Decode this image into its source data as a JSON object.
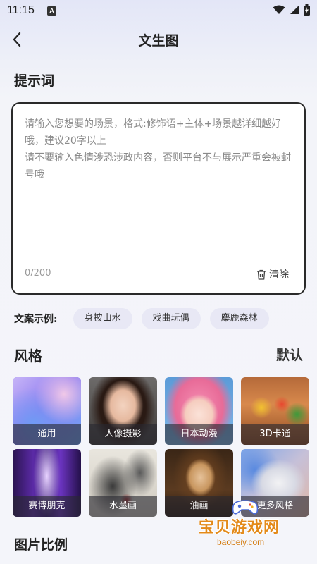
{
  "status": {
    "time": "11:15",
    "notif": "A"
  },
  "header": {
    "title": "文生图"
  },
  "prompt": {
    "section_title": "提示词",
    "placeholder": "请输入您想要的场景，格式:修饰语+主体+场景越详细越好哦，建议20字以上\n请不要输入色情涉恐涉政内容，否则平台不与展示严重会被封号哦",
    "char_count": "0/200",
    "clear_label": "清除"
  },
  "examples": {
    "label": "文案示例:",
    "chips": [
      "身披山水",
      "戏曲玩偶",
      "麋鹿森林"
    ]
  },
  "style": {
    "section_title": "风格",
    "default_label": "默认",
    "items": [
      {
        "label": "通用",
        "selected": true
      },
      {
        "label": "人像摄影"
      },
      {
        "label": "日本动漫"
      },
      {
        "label": "3D卡通"
      },
      {
        "label": "赛博朋克"
      },
      {
        "label": "水墨画"
      },
      {
        "label": "油画"
      },
      {
        "label": "更多风格"
      }
    ]
  },
  "ratio": {
    "section_title": "图片比例"
  },
  "watermark": {
    "text": "宝贝游戏网",
    "url": "baobeiy.com"
  },
  "colors": {
    "accent": "#5a5ae6",
    "chip_bg": "#e8e8f5",
    "border": "#2a2a2a"
  }
}
